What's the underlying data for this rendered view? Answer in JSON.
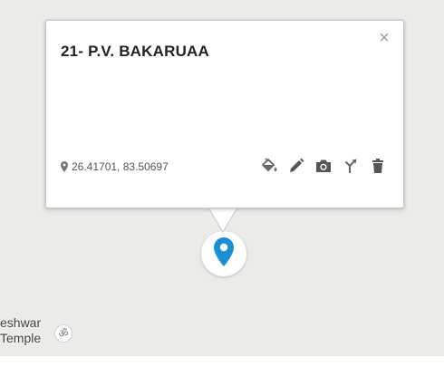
{
  "popup": {
    "title": "21- P.V. BAKARUAA",
    "close_glyph": "×",
    "coordinates": "26.41701, 83.50697",
    "tools": [
      {
        "icon": "paint-bucket-icon"
      },
      {
        "icon": "pencil-icon"
      },
      {
        "icon": "camera-icon"
      },
      {
        "icon": "directions-icon"
      },
      {
        "icon": "trash-icon"
      }
    ]
  },
  "map": {
    "background_color": "#ecebe8",
    "marker_color": "#1a8fd6",
    "poi": {
      "label_line1": "eshwar",
      "label_line2": "Temple",
      "icon_glyph": "ॐ"
    }
  }
}
